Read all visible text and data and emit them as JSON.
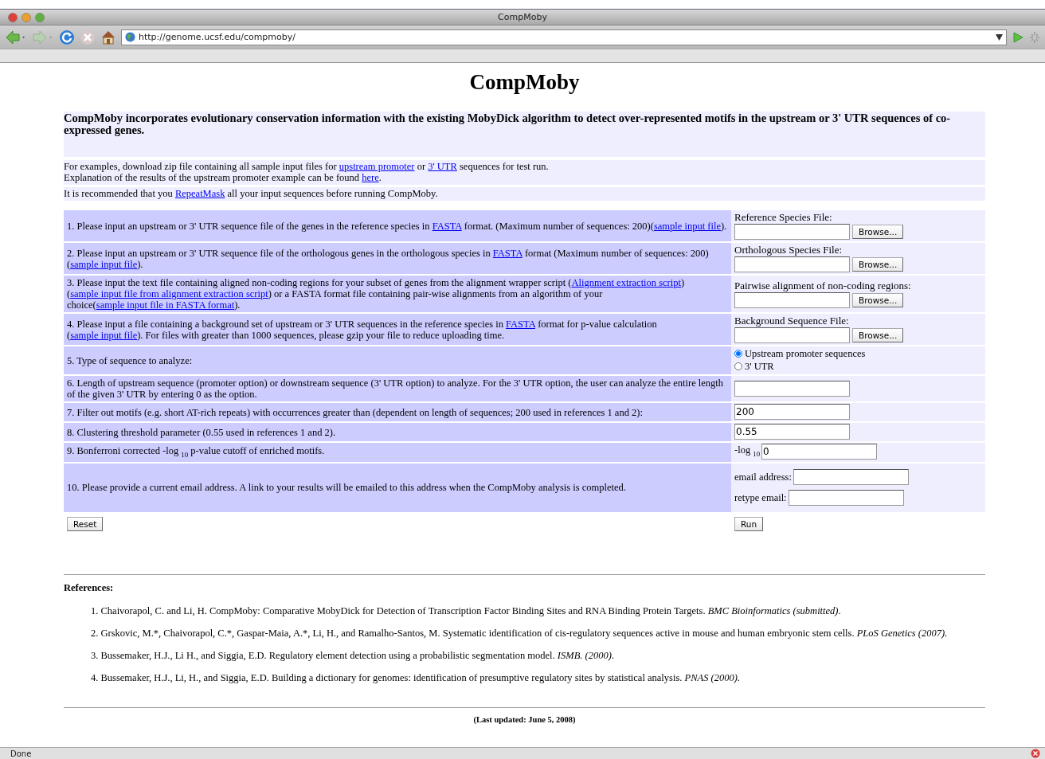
{
  "window": {
    "title": "CompMoby"
  },
  "toolbar": {
    "url": "http://genome.ucsf.edu/compmoby/"
  },
  "page": {
    "heading": "CompMoby",
    "summary": "CompMoby incorporates evolutionary conservation information with the existing MobyDick algorithm to detect over-represented motifs in the upstream or 3' UTR sequences of co-expressed genes.",
    "info_blocks": [
      {
        "lines": [
          [
            {
              "kind": "text",
              "text": "For examples, download zip file containing all sample input files for "
            },
            {
              "kind": "link",
              "text": "upstream promoter"
            },
            {
              "kind": "text",
              "text": " or "
            },
            {
              "kind": "link",
              "text": "3' UTR"
            },
            {
              "kind": "text",
              "text": " sequences for test run."
            }
          ],
          [
            {
              "kind": "text",
              "text": "Explanation of the results of the upstream promoter example can be found "
            },
            {
              "kind": "link",
              "text": "here"
            },
            {
              "kind": "text",
              "text": "."
            }
          ]
        ]
      },
      {
        "lines": [
          [
            {
              "kind": "text",
              "text": "It is recommended that you "
            },
            {
              "kind": "link",
              "text": "RepeatMask"
            },
            {
              "kind": "text",
              "text": " all your input sequences before running CompMoby."
            }
          ]
        ]
      }
    ],
    "form": {
      "rows": [
        {
          "question": [
            {
              "kind": "text",
              "text": "1. Please input an upstream or 3' UTR sequence file of the genes in the reference species in "
            },
            {
              "kind": "link",
              "text": "FASTA"
            },
            {
              "kind": "text",
              "text": " format. (Maximum number of sequences: 200)("
            },
            {
              "kind": "link",
              "text": "sample input file"
            },
            {
              "kind": "text",
              "text": ")."
            }
          ],
          "control": {
            "kind": "file",
            "label": "Reference Species File:",
            "button": "Browse..."
          }
        },
        {
          "question": [
            {
              "kind": "text",
              "text": "2. Please input an upstream or 3' UTR sequence file of the orthologous genes in the orthologous species in "
            },
            {
              "kind": "link",
              "text": "FASTA"
            },
            {
              "kind": "text",
              "text": " format (Maximum number of sequences: 200)("
            },
            {
              "kind": "link",
              "text": "sample input file"
            },
            {
              "kind": "text",
              "text": ")."
            }
          ],
          "control": {
            "kind": "file",
            "label": "Orthologous Species File:",
            "button": "Browse..."
          }
        },
        {
          "question": [
            {
              "kind": "text",
              "text": "3. Please input the text file containing aligned non-coding regions for your subset of genes from the alignment wrapper script ("
            },
            {
              "kind": "link",
              "text": "Alignment extraction script"
            },
            {
              "kind": "text",
              "text": ") ("
            },
            {
              "kind": "link",
              "text": "sample input file from alignment extraction script"
            },
            {
              "kind": "text",
              "text": ") or a FASTA format file containing pair-wise alignments from an algorithm of your choice("
            },
            {
              "kind": "link",
              "text": "sample input file in FASTA format"
            },
            {
              "kind": "text",
              "text": ")."
            }
          ],
          "control": {
            "kind": "file",
            "label": "Pairwise alignment of non-coding regions:",
            "button": "Browse..."
          }
        },
        {
          "question": [
            {
              "kind": "text",
              "text": "4. Please input a file containing a background set of upstream or 3' UTR sequences in the reference species in "
            },
            {
              "kind": "link",
              "text": "FASTA"
            },
            {
              "kind": "text",
              "text": " format for p-value calculation ("
            },
            {
              "kind": "link",
              "text": "sample input file"
            },
            {
              "kind": "text",
              "text": "). For files with greater than 1000 sequences, please gzip your file to reduce uploading time."
            }
          ],
          "control": {
            "kind": "file",
            "label": "Background Sequence File:",
            "button": "Browse..."
          }
        },
        {
          "question": [
            {
              "kind": "text",
              "text": "5. Type of sequence to analyze:"
            }
          ],
          "control": {
            "kind": "radio",
            "options": [
              {
                "label": "Upstream promoter sequences",
                "selected": true
              },
              {
                "label": "3' UTR",
                "selected": false
              }
            ]
          }
        },
        {
          "question": [
            {
              "kind": "text",
              "text": "6. Length of upstream sequence (promoter option) or downstream sequence (3' UTR option) to analyze. For the 3' UTR option, the user can analyze the entire length of the given 3' UTR by entering 0 as the option."
            }
          ],
          "control": {
            "kind": "text"
          }
        },
        {
          "question": [
            {
              "kind": "text",
              "text": "7. Filter out motifs (e.g. short AT-rich repeats) with occurrences greater than (dependent on length of sequences; 200 used in references 1 and 2):"
            }
          ],
          "control": {
            "kind": "text",
            "value": "200"
          }
        },
        {
          "question": [
            {
              "kind": "text",
              "text": "8. Clustering threshold parameter (0.55 used in references 1 and 2)."
            }
          ],
          "control": {
            "kind": "text",
            "value": "0.55"
          }
        },
        {
          "question": [
            {
              "kind": "rich",
              "text": "9. Bonferroni corrected -log $_{10}$ p-value cutoff of enriched motifs."
            }
          ],
          "control": {
            "kind": "prefixed",
            "prefix": "-log $_{10}$",
            "value": "0"
          }
        },
        {
          "question": [
            {
              "kind": "text",
              "text": "10. Please provide a current email address. A link to your results will be emailed to this address when the CompMoby analysis is completed."
            }
          ],
          "control": {
            "kind": "labeled_fields",
            "fields": [
              {
                "label": "email address:"
              },
              {
                "label": "retype email:"
              }
            ]
          }
        }
      ],
      "reset_button": "Reset",
      "run_button": "Run"
    },
    "references": {
      "heading": "References:",
      "items": [
        [
          {
            "kind": "text",
            "text": "1. Chaivorapol, C. and Li, H. CompMoby: Comparative MobyDick for Detection of Transcription Factor Binding Sites and RNA Binding Protein Targets. "
          },
          {
            "kind": "italic",
            "text": "BMC Bioinformatics (submitted)"
          },
          {
            "kind": "text",
            "text": "."
          }
        ],
        [
          {
            "kind": "text",
            "text": "2. Grskovic, M.*, Chaivorapol, C.*, Gaspar-Maia, A.*, Li, H., and Ramalho-Santos, M. Systematic identification of cis-regulatory sequences active in mouse and human embryonic stem cells. "
          },
          {
            "kind": "italic",
            "text": "PLoS Genetics (2007)"
          },
          {
            "kind": "text",
            "text": "."
          }
        ],
        [
          {
            "kind": "text",
            "text": "3. Bussemaker, H.J., Li H., and Siggia, E.D. Regulatory element detection using a probabilistic segmentation model. "
          },
          {
            "kind": "italic",
            "text": "ISMB. (2000)"
          },
          {
            "kind": "text",
            "text": "."
          }
        ],
        [
          {
            "kind": "text",
            "text": "4. Bussemaker, H.J., Li, H., and Siggia, E.D. Building a dictionary for genomes: identification of presumptive regulatory sites by statistical analysis. "
          },
          {
            "kind": "italic",
            "text": "PNAS (2000)"
          },
          {
            "kind": "text",
            "text": "."
          }
        ]
      ]
    },
    "footer": "(Last updated: June 5, 2008)"
  },
  "status_bar": {
    "text": "Done"
  }
}
